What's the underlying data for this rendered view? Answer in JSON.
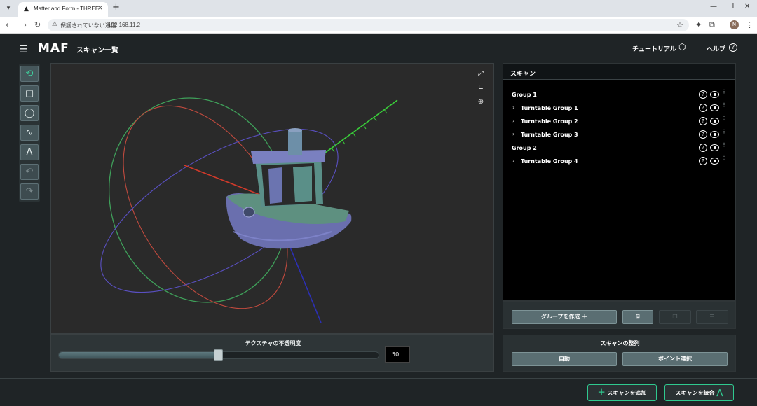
{
  "browser": {
    "tab_title": "Matter and Form - THREE",
    "tab_close": "×",
    "new_tab": "+",
    "security_label": "保護されていない通信",
    "url": "192.168.11.2"
  },
  "header": {
    "logo": "MAF",
    "title": "スキャン一覧",
    "tutorial_label": "チュートリアル",
    "help_label": "ヘルプ"
  },
  "viewport": {
    "opacity_label": "テクスチャの不透明度",
    "opacity_value": "50",
    "opacity_fraction": 0.5
  },
  "scan_panel": {
    "title": "スキャン",
    "tree": [
      {
        "label": "Group 1",
        "level": 0
      },
      {
        "label": "Turntable Group 1",
        "level": 1
      },
      {
        "label": "Turntable Group 2",
        "level": 1
      },
      {
        "label": "Turntable Group 3",
        "level": 1
      },
      {
        "label": "Group 2",
        "level": 0
      },
      {
        "label": "Turntable Group 4",
        "level": 1
      }
    ],
    "create_group_label": "グループを作成 ＋"
  },
  "align_panel": {
    "title": "スキャンの整列",
    "auto_label": "自動",
    "point_label": "ポイント選択"
  },
  "footer": {
    "add_scan_label": "スキャンを追加",
    "merge_scan_label": "スキャンを統合"
  },
  "colors": {
    "accent_green": "#2fc98f",
    "panel_bg": "#2a3133",
    "button_bg": "#5a6e72"
  }
}
